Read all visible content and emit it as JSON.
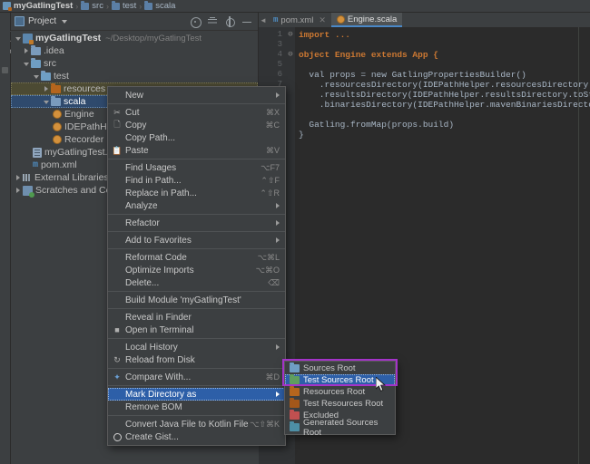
{
  "breadcrumb": {
    "items": [
      {
        "label": "myGatlingTest",
        "icon": "module-icon"
      },
      {
        "label": "src",
        "icon": "folder-icon"
      },
      {
        "label": "test",
        "icon": "folder-icon"
      },
      {
        "label": "scala",
        "icon": "folder-icon"
      }
    ],
    "separator": "›"
  },
  "left_strip": {
    "project_tab": "Project"
  },
  "project_panel": {
    "title": "Project",
    "tools": [
      "locate-icon",
      "collapse-all-icon",
      "settings-icon",
      "hide-icon"
    ],
    "tree": [
      {
        "label": "myGatlingTest",
        "sub": "~/Desktop/myGatlingTest",
        "arrow": "down",
        "icon": "module-icon",
        "indent": 0,
        "state": "root"
      },
      {
        "label": ".idea",
        "arrow": "right",
        "icon": "folder-icon",
        "indent": 1,
        "state": "normal"
      },
      {
        "label": "src",
        "arrow": "down",
        "icon": "folder-icon",
        "indent": 1,
        "state": "normal"
      },
      {
        "label": "test",
        "arrow": "down",
        "icon": "folder-icon",
        "indent": 2,
        "state": "normal"
      },
      {
        "label": "resources",
        "arrow": "right",
        "icon": "resources-folder-icon",
        "indent": 3,
        "state": "olive"
      },
      {
        "label": "scala",
        "arrow": "down",
        "icon": "folder-icon",
        "indent": 3,
        "state": "selected"
      },
      {
        "label": "Engine",
        "arrow": "none",
        "icon": "scala-object-icon",
        "indent": 4,
        "state": "normal"
      },
      {
        "label": "IDEPathHelper",
        "arrow": "none",
        "icon": "scala-object-icon",
        "indent": 4,
        "state": "normal"
      },
      {
        "label": "Recorder",
        "arrow": "none",
        "icon": "scala-object-icon",
        "indent": 4,
        "state": "normal"
      },
      {
        "label": "myGatlingTest.iml",
        "arrow": "none",
        "icon": "iml-file-icon",
        "indent": 2,
        "state": "normal"
      },
      {
        "label": "pom.xml",
        "arrow": "none",
        "icon": "maven-xml-icon",
        "indent": 2,
        "state": "normal"
      },
      {
        "label": "External Libraries",
        "arrow": "right",
        "icon": "libraries-icon",
        "indent": 0,
        "state": "normal"
      },
      {
        "label": "Scratches and Consoles",
        "arrow": "right",
        "icon": "scratches-icon",
        "indent": 0,
        "state": "normal"
      }
    ]
  },
  "editor": {
    "tabs": [
      {
        "label": "pom.xml",
        "icon": "maven-xml-icon",
        "active": false,
        "closable": true
      },
      {
        "label": "Engine.scala",
        "icon": "scala-object-icon",
        "active": true,
        "closable": false
      }
    ],
    "line_numbers": [
      "1",
      "3",
      "4",
      "5",
      "6",
      "7"
    ],
    "code_lines": [
      "import ...",
      "",
      "object Engine extends App {",
      "",
      "  val props = new GatlingPropertiesBuilder()",
      "    .resourcesDirectory(IDEPathHelper.resourcesDirectory.toString)",
      "    .resultsDirectory(IDEPathHelper.resultsDirectory.toString)",
      "    .binariesDirectory(IDEPathHelper.mavenBinariesDirectory.toString)",
      "",
      "  Gatling.fromMap(props.build)",
      "}"
    ]
  },
  "context_menu": {
    "items": [
      {
        "label": "New",
        "shortcut": "",
        "icon": "",
        "submenu": true,
        "selected": false
      },
      {
        "sep": true
      },
      {
        "label": "Cut",
        "shortcut": "⌘X",
        "icon": "scissors-icon",
        "submenu": false,
        "selected": false
      },
      {
        "label": "Copy",
        "shortcut": "⌘C",
        "icon": "copy-icon",
        "submenu": false,
        "selected": false
      },
      {
        "label": "Copy Path...",
        "shortcut": "",
        "icon": "",
        "submenu": false,
        "selected": false
      },
      {
        "label": "Paste",
        "shortcut": "⌘V",
        "icon": "clipboard-icon",
        "submenu": false,
        "selected": false
      },
      {
        "sep": true
      },
      {
        "label": "Find Usages",
        "shortcut": "⌥F7",
        "icon": "",
        "submenu": false,
        "selected": false
      },
      {
        "label": "Find in Path...",
        "shortcut": "⌃⇧F",
        "icon": "",
        "submenu": false,
        "selected": false
      },
      {
        "label": "Replace in Path...",
        "shortcut": "⌃⇧R",
        "icon": "",
        "submenu": false,
        "selected": false
      },
      {
        "label": "Analyze",
        "shortcut": "",
        "icon": "",
        "submenu": true,
        "selected": false
      },
      {
        "sep": true
      },
      {
        "label": "Refactor",
        "shortcut": "",
        "icon": "",
        "submenu": true,
        "selected": false
      },
      {
        "sep": true
      },
      {
        "label": "Add to Favorites",
        "shortcut": "",
        "icon": "",
        "submenu": true,
        "selected": false
      },
      {
        "sep": true
      },
      {
        "label": "Reformat Code",
        "shortcut": "⌥⌘L",
        "icon": "",
        "submenu": false,
        "selected": false
      },
      {
        "label": "Optimize Imports",
        "shortcut": "⌥⌘O",
        "icon": "",
        "submenu": false,
        "selected": false
      },
      {
        "label": "Delete...",
        "shortcut": "⌫",
        "icon": "",
        "submenu": false,
        "selected": false
      },
      {
        "sep": true
      },
      {
        "label": "Build Module 'myGatlingTest'",
        "shortcut": "",
        "icon": "",
        "submenu": false,
        "selected": false
      },
      {
        "sep": true
      },
      {
        "label": "Reveal in Finder",
        "shortcut": "",
        "icon": "",
        "submenu": false,
        "selected": false
      },
      {
        "label": "Open in Terminal",
        "shortcut": "",
        "icon": "terminal-icon",
        "submenu": false,
        "selected": false
      },
      {
        "sep": true
      },
      {
        "label": "Local History",
        "shortcut": "",
        "icon": "",
        "submenu": true,
        "selected": false
      },
      {
        "label": "Reload from Disk",
        "shortcut": "",
        "icon": "refresh-icon",
        "submenu": false,
        "selected": false
      },
      {
        "sep": true
      },
      {
        "label": "Compare With...",
        "shortcut": "⌘D",
        "icon": "compare-icon",
        "submenu": false,
        "selected": false
      },
      {
        "sep": true
      },
      {
        "label": "Mark Directory as",
        "shortcut": "",
        "icon": "",
        "submenu": true,
        "selected": true
      },
      {
        "label": "Remove BOM",
        "shortcut": "",
        "icon": "",
        "submenu": false,
        "selected": false
      },
      {
        "sep": true
      },
      {
        "label": "Convert Java File to Kotlin File",
        "shortcut": "⌥⇧⌘K",
        "icon": "",
        "submenu": false,
        "selected": false
      },
      {
        "label": "Create Gist...",
        "shortcut": "",
        "icon": "github-icon",
        "submenu": false,
        "selected": false
      }
    ]
  },
  "submenu": {
    "items": [
      {
        "label": "Sources Root",
        "icon_color": "blue",
        "selected": false
      },
      {
        "label": "Test Sources Root",
        "icon_color": "green",
        "selected": true
      },
      {
        "label": "Resources Root",
        "icon_color": "brown",
        "selected": false
      },
      {
        "label": "Test Resources Root",
        "icon_color": "brown2",
        "selected": false
      },
      {
        "label": "Excluded",
        "icon_color": "red",
        "selected": false
      },
      {
        "label": "Generated Sources Root",
        "icon_color": "teal",
        "selected": false
      }
    ]
  },
  "annotation": {
    "highlight_color": "#a333c8"
  }
}
